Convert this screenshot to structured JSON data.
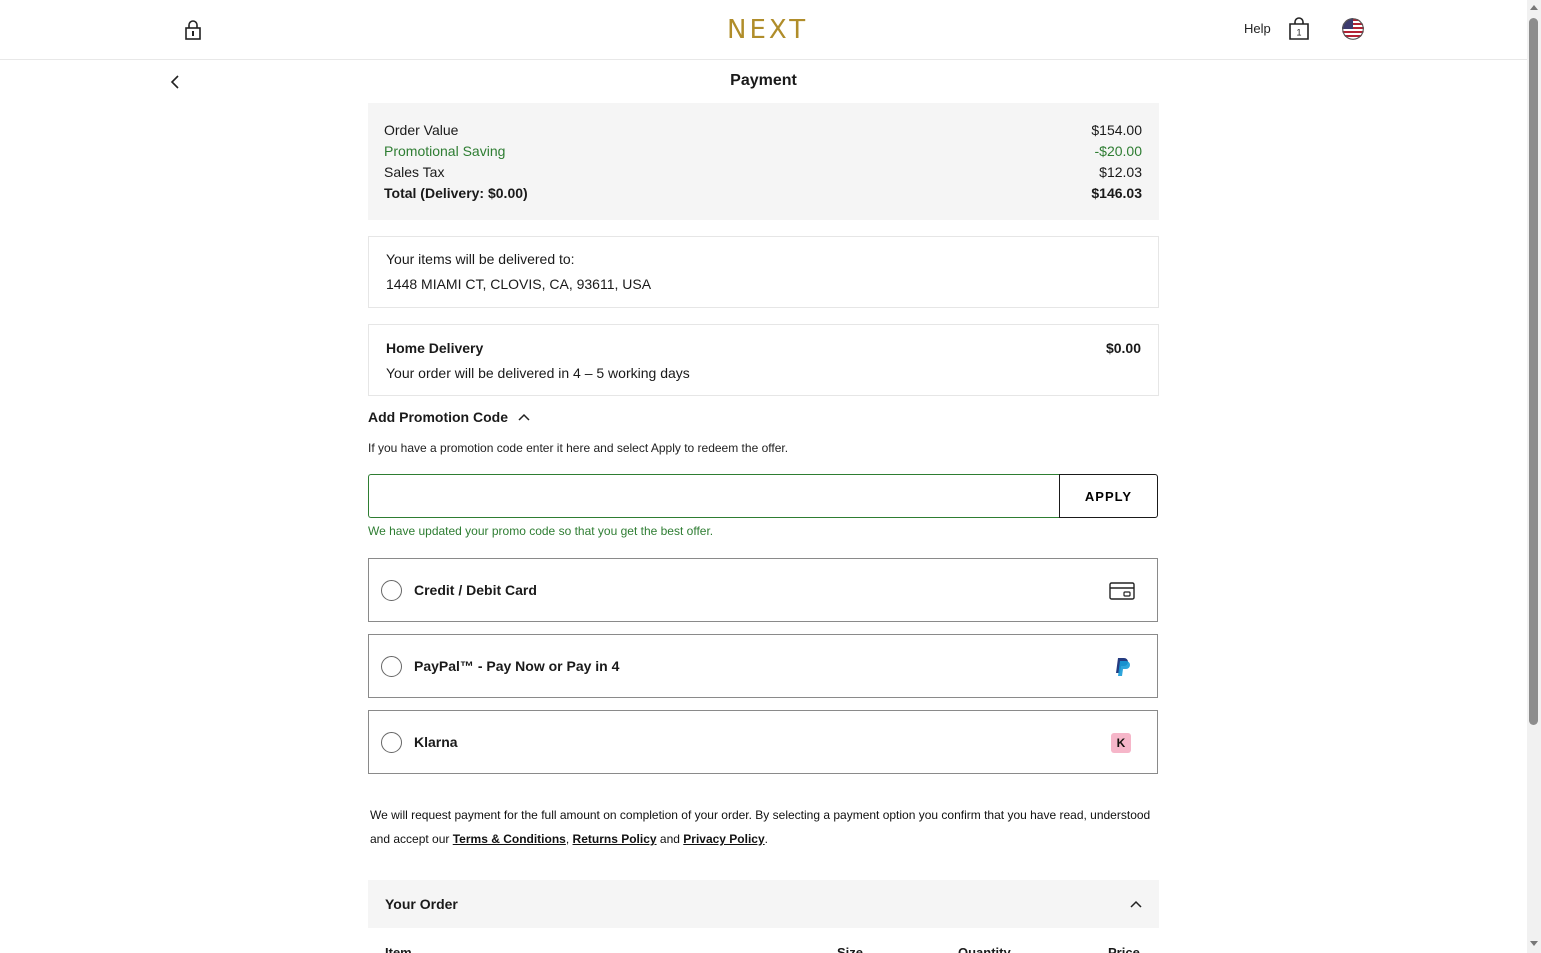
{
  "header": {
    "logo": "NEXT",
    "help_label": "Help",
    "bag_count": "1"
  },
  "page_title": "Payment",
  "summary": {
    "order_value_label": "Order Value",
    "order_value": "$154.00",
    "promo_label": "Promotional Saving",
    "promo_value": "-$20.00",
    "tax_label": "Sales Tax",
    "tax_value": "$12.03",
    "total_label": "Total (Delivery: $0.00)",
    "total_value": "$146.03"
  },
  "address": {
    "heading": "Your items will be delivered to:",
    "line": "1448 MIAMI CT, CLOVIS, CA, 93611, USA"
  },
  "delivery": {
    "method": "Home Delivery",
    "price": "$0.00",
    "note": "Your order will be delivered in 4 – 5 working days"
  },
  "promotion": {
    "toggle_label": "Add Promotion Code",
    "info": "If you have a promotion code enter it here and select Apply to redeem the offer.",
    "input_value": "",
    "apply_label": "APPLY",
    "message": "We have updated your promo code so that you get the best offer."
  },
  "payment_options": [
    {
      "label": "Credit / Debit Card",
      "icon": "credit-card-icon"
    },
    {
      "label": "PayPal™ - Pay Now or Pay in 4",
      "icon": "paypal-icon"
    },
    {
      "label": "Klarna",
      "icon": "klarna-icon",
      "badge": "K"
    }
  ],
  "legal": {
    "text_1": "We will request payment for the full amount on completion of your order. By selecting a payment option you confirm that you have read, understood and accept our ",
    "terms": "Terms & Conditions",
    "comma": ", ",
    "returns": "Returns Policy",
    "and": " and ",
    "privacy": "Privacy Policy",
    "end": "."
  },
  "your_order": {
    "title": "Your Order",
    "columns": [
      "Item",
      "Size",
      "Quantity",
      "Price"
    ]
  },
  "colors": {
    "brand": "#b08d2a",
    "promo_green": "#2e7d32",
    "panel_bg": "#f5f5f5"
  }
}
